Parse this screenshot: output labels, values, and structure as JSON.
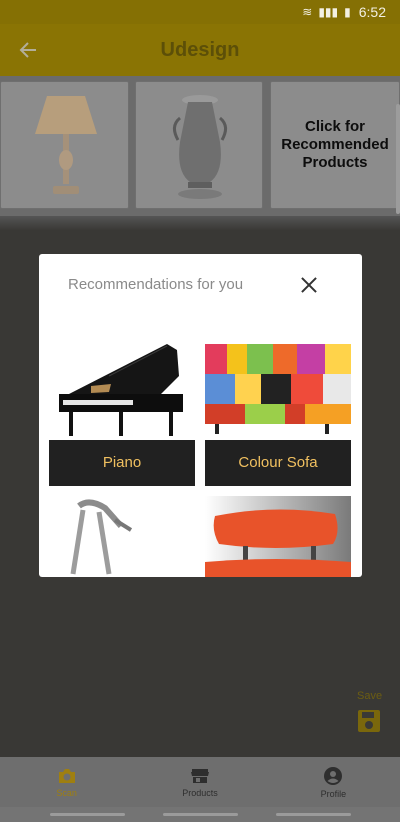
{
  "status_bar": {
    "time": "6:52"
  },
  "app_bar": {
    "title": "Udesign"
  },
  "product_strip": {
    "tiles": [
      {
        "name": "lamp"
      },
      {
        "name": "vase"
      },
      {
        "label": "Click for Recommended Products"
      }
    ]
  },
  "modal": {
    "title": "Recommendations for you",
    "items": [
      {
        "caption": "Piano"
      },
      {
        "caption": "Colour Sofa"
      },
      {
        "caption": ""
      },
      {
        "caption": ""
      }
    ]
  },
  "save": {
    "label": "Save"
  },
  "bottom_nav": {
    "items": [
      {
        "label": "Scan",
        "icon": "camera-icon",
        "active": true
      },
      {
        "label": "Products",
        "icon": "store-icon",
        "active": false
      },
      {
        "label": "Profile",
        "icon": "account-circle-icon",
        "active": false
      }
    ]
  },
  "colors": {
    "accent": "#f2cc0c",
    "caption_text": "#f0c060"
  }
}
